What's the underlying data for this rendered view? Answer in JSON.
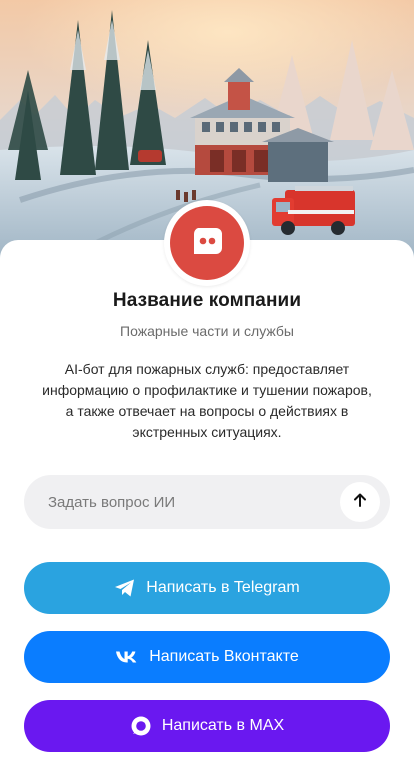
{
  "company": {
    "name": "Название компании",
    "category": "Пожарные части и службы",
    "description": "AI-бот для пожарных служб: предоставляет информацию о профилактике и тушении пожаров, а также отвечает на вопросы о действиях в экстренных ситуациях.",
    "avatar_icon": "chat-bubble-icon"
  },
  "ask": {
    "placeholder": "Задать вопрос ИИ",
    "value": "",
    "send_icon": "arrow-up-icon"
  },
  "buttons": {
    "telegram": {
      "label": "Написать в Telegram",
      "icon": "telegram-icon"
    },
    "vk": {
      "label": "Написать Вконтакте",
      "icon": "vk-icon"
    },
    "max": {
      "label": "Написать в MAX",
      "icon": "max-icon"
    }
  },
  "colors": {
    "avatar": "#db4a41",
    "telegram": "#2aa3e0",
    "vk": "#0a7dff",
    "max": "#6a18f0",
    "ask_bar": "#f0f0f2"
  }
}
